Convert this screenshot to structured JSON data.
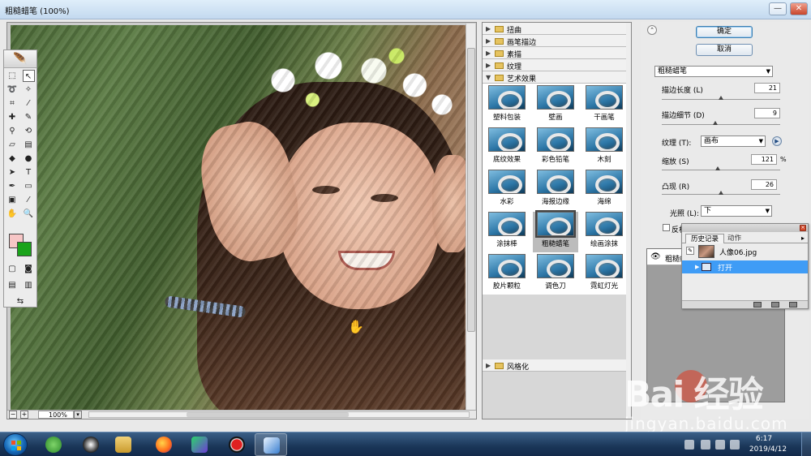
{
  "window": {
    "title": "粗糙蜡笔 (100%)",
    "minimize": "—",
    "close": "✕"
  },
  "preview": {
    "zoom_value": "100%",
    "zoom_out": "−",
    "zoom_in": "+",
    "zoom_dropdown": "▾"
  },
  "gallery": {
    "categories_top": [
      "扭曲",
      "画笔描边",
      "素描",
      "纹理"
    ],
    "expanded_category": "艺术效果",
    "filters": [
      "塑料包装",
      "壁画",
      "干画笔",
      "底纹效果",
      "彩色铅笔",
      "木刻",
      "水彩",
      "海报边缘",
      "海绵",
      "涂抹棒",
      "粗糙蜡笔",
      "绘画涂抹",
      "胶片颗粒",
      "调色刀",
      "霓虹灯光"
    ],
    "selected_filter": "粗糙蜡笔",
    "categories_bottom": [
      "风格化"
    ]
  },
  "options": {
    "ok_label": "确定",
    "cancel_label": "取消",
    "filter_select": "粗糙蜡笔",
    "stroke_length": {
      "label": "描边长度 (L)",
      "value": "21",
      "fraction": 0.5
    },
    "stroke_detail": {
      "label": "描边细节 (D)",
      "value": "9",
      "fraction": 0.45
    },
    "texture": {
      "label": "纹理 (T):",
      "value": "画布"
    },
    "scaling": {
      "label": "缩放 (S)",
      "value": "121",
      "unit": "%",
      "fraction": 0.47
    },
    "relief": {
      "label": "凸现 (R)",
      "value": "26",
      "fraction": 0.5
    },
    "light": {
      "label": "光照 (L):",
      "value": "下"
    },
    "invert": {
      "label": "反相"
    }
  },
  "layer": {
    "label": "粗糙蜡"
  },
  "history": {
    "tab_history": "历史记录",
    "tab_actions": "动作",
    "snapshot": "人像06.jpg",
    "state": "打开"
  },
  "watermark": {
    "main": "Bai  经验",
    "sub": "jingyan.baidu.com"
  },
  "taskbar": {
    "time": "6:17",
    "date": "2019/4/12"
  },
  "colors": {
    "foreground": "#f7c6c6",
    "background": "#1aa31a",
    "selection": "#3f9cf6"
  }
}
